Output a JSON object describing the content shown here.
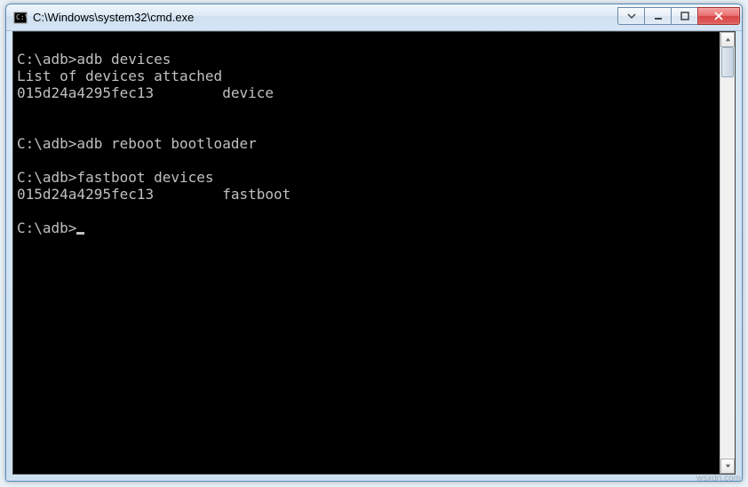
{
  "window": {
    "title": "C:\\Windows\\system32\\cmd.exe"
  },
  "console": {
    "lines": [
      "",
      "C:\\adb>adb devices",
      "List of devices attached",
      "015d24a4295fec13        device",
      "",
      "",
      "C:\\adb>adb reboot bootloader",
      "",
      "C:\\adb>fastboot devices",
      "015d24a4295fec13        fastboot",
      "",
      "C:\\adb>"
    ]
  },
  "watermark": "wsxdn.com"
}
